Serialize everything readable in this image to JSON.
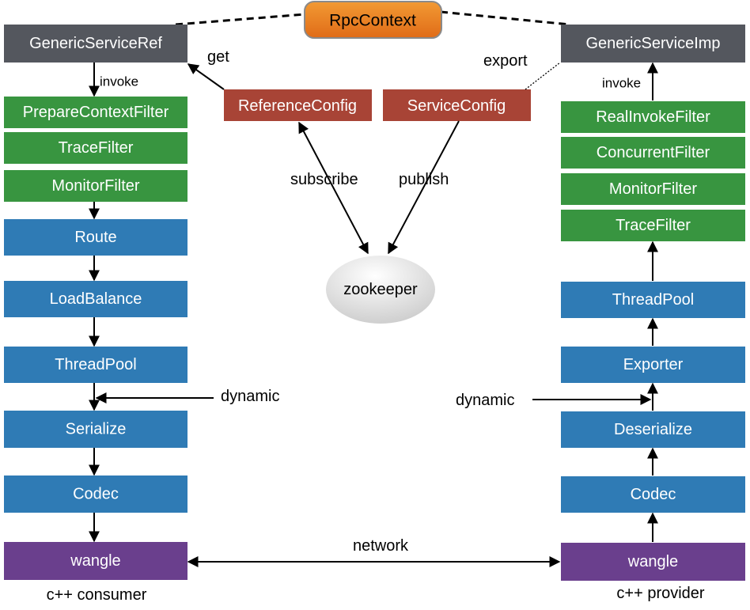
{
  "colors": {
    "service": "#54575e",
    "filter": "#389540",
    "core": "#2f7bb5",
    "transport": "#6a3f8d",
    "config": "#a84436",
    "context": "#e9791f",
    "registry": "#e6e6e6"
  },
  "context": {
    "label": "RpcContext"
  },
  "registry": {
    "label": "zookeeper"
  },
  "consumer": {
    "service": "GenericServiceRef",
    "invoke_label": "invoke",
    "filters": [
      "PrepareContextFilter",
      "TraceFilter",
      "MonitorFilter"
    ],
    "core": [
      "Route",
      "LoadBalance",
      "ThreadPool",
      "Serialize",
      "Codec"
    ],
    "transport": "wangle",
    "caption": "c++ consumer",
    "dynamic_label": "dynamic"
  },
  "provider": {
    "service": "GenericServiceImp",
    "invoke_label": "invoke",
    "filters": [
      "RealInvokeFilter",
      "ConcurrentFilter",
      "MonitorFilter",
      "TraceFilter"
    ],
    "core": [
      "ThreadPool",
      "Exporter",
      "Deserialize",
      "Codec"
    ],
    "transport": "wangle",
    "caption": "c++ provider",
    "dynamic_label": "dynamic"
  },
  "config": {
    "reference": "ReferenceConfig",
    "service": "ServiceConfig",
    "get_label": "get",
    "export_label": "export",
    "subscribe_label": "subscribe",
    "publish_label": "publish"
  },
  "network_label": "network"
}
